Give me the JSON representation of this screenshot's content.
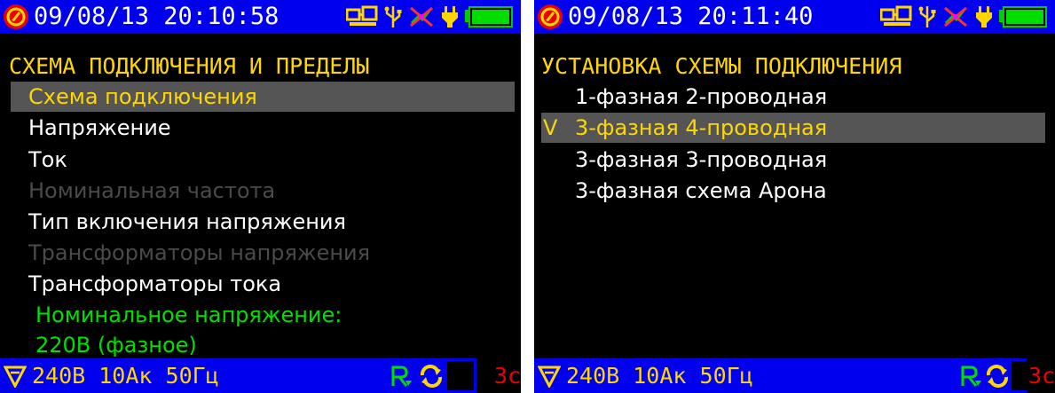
{
  "left_screen": {
    "datetime": "09/08/13 20:10:58",
    "title": "СХЕМА ПОДКЛЮЧЕНИЯ И ПРЕДЕЛЫ",
    "menu": [
      "Схема подключения",
      "Напряжение",
      "Ток",
      "Номинальная частота",
      "Тип включения напряжения",
      "Трансформаторы напряжения",
      "Трансформаторы тока"
    ],
    "note_line1": "Номинальное напряжение:",
    "note_line2": "220В (фазное)",
    "measurements": "240В 10Ак 50Гц",
    "timer": "3с"
  },
  "right_screen": {
    "datetime": "09/08/13 20:11:40",
    "title": "УСТАНОВКА СХЕМЫ ПОДКЛЮЧЕНИЯ",
    "options": [
      "1-фазная 2-проводная",
      "3-фазная 4-проводная",
      "3-фазная 3-проводная",
      "3-фазная схема Арона"
    ],
    "check_mark": "V",
    "measurements": "240В 10Ак 50Гц",
    "timer": "3с"
  },
  "colors": {
    "status_bar": "#0000ee",
    "title": "#ffd700",
    "selected_bg": "#555555",
    "disabled_text": "#4a4a4a",
    "note_text": "#00e000",
    "timer_text": "#ee0000"
  },
  "status_icons": [
    "logo-icon",
    "network-icon",
    "usb-icon",
    "gps-off-icon",
    "power-plug-icon",
    "battery-icon"
  ],
  "bottom_icons": [
    "filter-icon",
    "recording-icon",
    "refresh-icon"
  ]
}
